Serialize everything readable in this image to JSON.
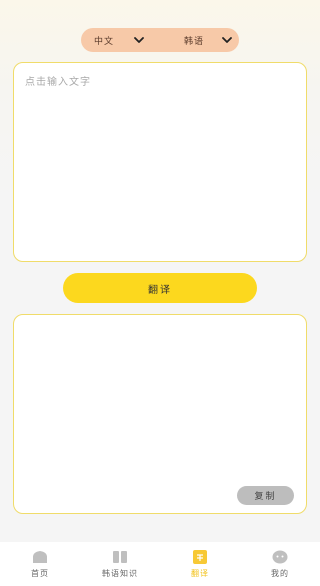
{
  "language_bar": {
    "source_language": "中文",
    "target_language": "韩语"
  },
  "input": {
    "placeholder": "点击输入文字",
    "value": ""
  },
  "translate_button": {
    "label": "翻译"
  },
  "output": {
    "text": "",
    "copy_label": "复制"
  },
  "tabbar": {
    "items": [
      {
        "label": "首页",
        "icon": "home-icon"
      },
      {
        "label": "韩语知识",
        "icon": "book-icon"
      },
      {
        "label": "翻译",
        "icon": "translate-icon",
        "active": true
      },
      {
        "label": "我的",
        "icon": "profile-icon"
      }
    ]
  },
  "colors": {
    "accent": "#fcd81e",
    "active_tab": "#f2c21a",
    "language_bar_bg": "#f7c9a8",
    "box_border": "#f0dc6a",
    "copy_button_bg": "#bdbdbd",
    "tab_icon_inactive": "#bfbfbf"
  }
}
